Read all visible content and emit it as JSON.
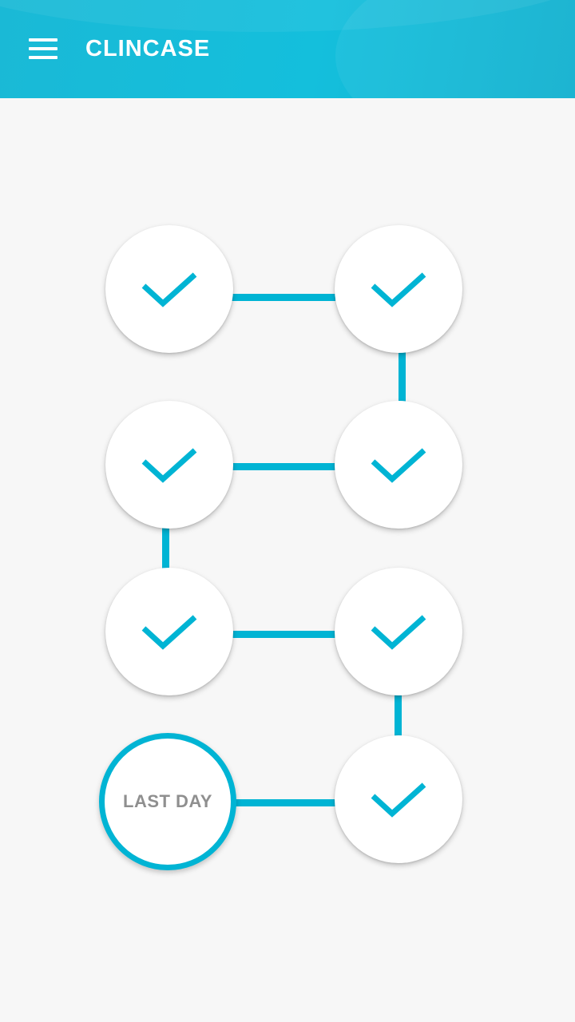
{
  "header": {
    "title": "CLINCASE",
    "menu_icon": "hamburger-menu-icon",
    "background_color": "#14bfdc"
  },
  "progress": {
    "accent_color": "#00b4d4",
    "completed_icon": "checkmark-icon",
    "completed_days": 7,
    "total_days": 8,
    "last_day_label": "LAST DAY"
  }
}
